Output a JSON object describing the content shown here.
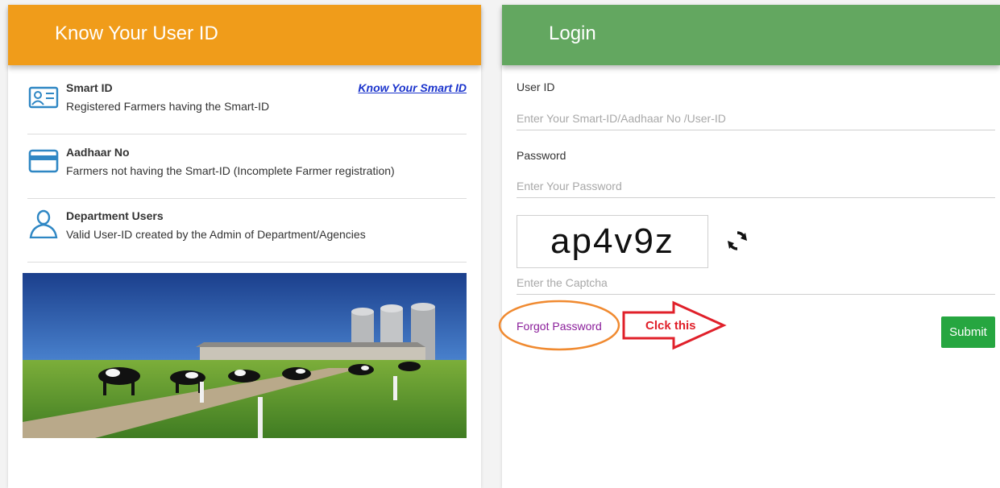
{
  "left": {
    "header": "Know Your User ID",
    "know_link": "Know Your Smart ID",
    "items": [
      {
        "title": "Smart ID",
        "desc": "Registered Farmers having the Smart-ID",
        "icon": "id-card-icon"
      },
      {
        "title": "Aadhaar No",
        "desc": "Farmers not having the Smart-ID (Incomplete Farmer registration)",
        "icon": "card-icon"
      },
      {
        "title": "Department Users",
        "desc": "Valid User-ID created by the Admin of Department/Agencies",
        "icon": "user-icon"
      }
    ]
  },
  "login": {
    "header": "Login",
    "userid_label": "User ID",
    "userid_placeholder": "Enter Your Smart-ID/Aadhaar No /User-ID",
    "userid_value": "",
    "password_label": "Password",
    "password_placeholder": "Enter Your Password",
    "password_value": "",
    "captcha_text": "ap4v9z",
    "captcha_placeholder": "Enter the Captcha",
    "captcha_value": "",
    "forgot_label": "Forgot Password",
    "submit_label": "Submit"
  },
  "annotation": {
    "arrow_label": "Clck this"
  },
  "colors": {
    "left_header": "#f09c1a",
    "login_header": "#63a760",
    "submit": "#26a640",
    "annotation_red": "#e0202a",
    "annotation_orange": "#f08a30"
  }
}
